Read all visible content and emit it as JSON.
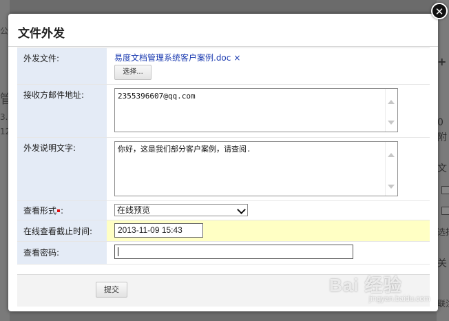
{
  "dialog": {
    "title": "文件外发",
    "close_symbol": "✕"
  },
  "form": {
    "attachment": {
      "label": "外发文件:",
      "file_name": "易度文档管理系统客户案例.doc",
      "remove_symbol": "×",
      "choose_button": "选择..."
    },
    "recipient_email": {
      "label": "接收方邮件地址:",
      "value": "2355396607@qq.com"
    },
    "description": {
      "label": "外发说明文字:",
      "value": "你好，这是我们部分客户案例，请查阅."
    },
    "view_mode": {
      "label": "查看形式",
      "label_suffix": ":",
      "selected": "在线预览"
    },
    "deadline": {
      "label": "在线查看截止时间:",
      "value": "2013-11-09 15:43"
    },
    "password": {
      "label": "查看密码:",
      "value": ""
    }
  },
  "footer": {
    "submit_button": "提交"
  },
  "background": {
    "left_fragments": [
      "公告",
      "管",
      "3.",
      "12"
    ],
    "right_fragments": [
      "+",
      "0",
      "附",
      "文",
      "选择",
      "关",
      "联注"
    ]
  },
  "watermark": {
    "brand": "Bai 经验",
    "url": "jingyan.baidu.com"
  },
  "colors": {
    "label_bg": "#e4ebf6",
    "highlight_row": "#ffffc4",
    "link": "#1a3ab0",
    "required_mark": "#e01010"
  }
}
